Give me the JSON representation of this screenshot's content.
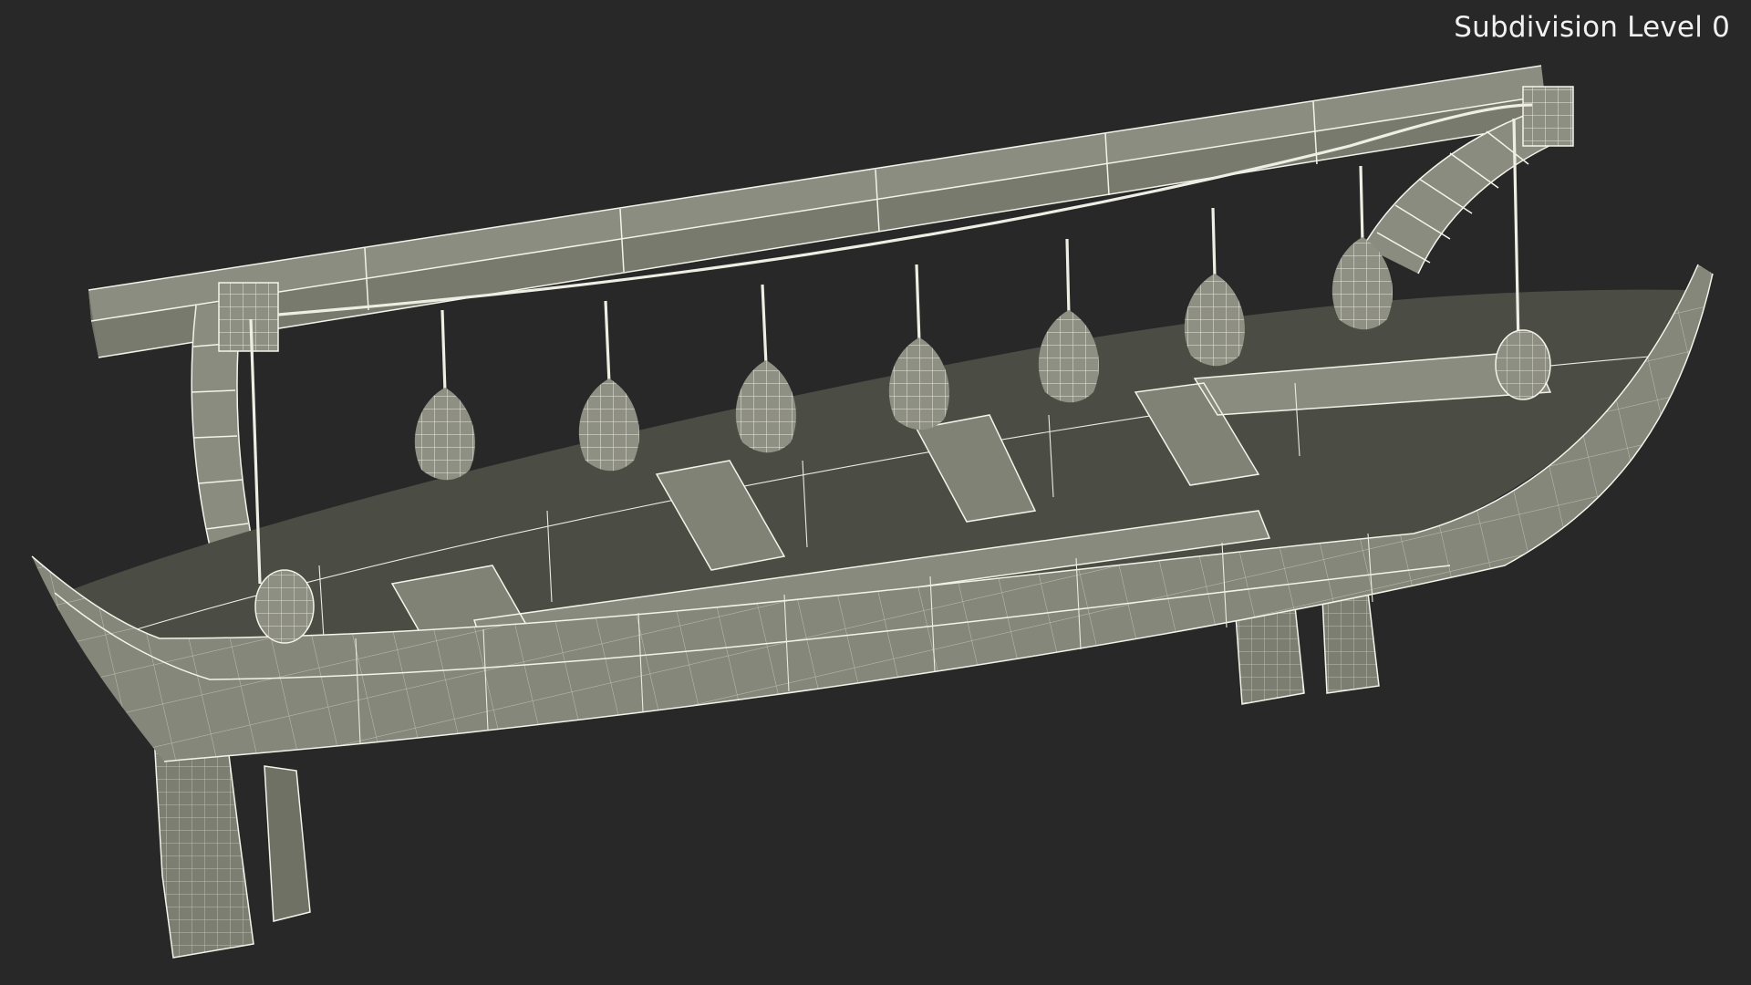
{
  "viewport": {
    "label": "Subdivision Level 0",
    "background_color": "#282828",
    "model_color": "#85877a",
    "wire_color": "#f4f3ea"
  },
  "model": {
    "subject": "lifeboat with davit beam and hanging fenders",
    "fender_count": 7,
    "davit_count": 2
  }
}
